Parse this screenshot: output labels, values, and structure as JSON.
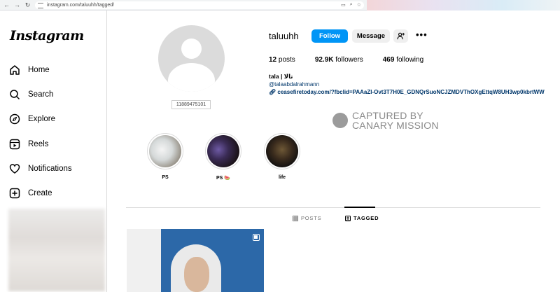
{
  "browser": {
    "url": "instagram.com/taluuhh/tagged/"
  },
  "sidebar": {
    "logo": "Instagram",
    "items": [
      {
        "label": "Home",
        "icon": "home-icon"
      },
      {
        "label": "Search",
        "icon": "search-icon"
      },
      {
        "label": "Explore",
        "icon": "compass-icon"
      },
      {
        "label": "Reels",
        "icon": "reels-icon"
      },
      {
        "label": "Notifications",
        "icon": "heart-icon"
      },
      {
        "label": "Create",
        "icon": "plus-square-icon"
      }
    ]
  },
  "profile": {
    "avatar_label": "11889475101",
    "username": "taluuhh",
    "follow_label": "Follow",
    "message_label": "Message",
    "stats": {
      "posts": "12",
      "posts_label": "posts",
      "followers": "92.9K",
      "followers_label": "followers",
      "following": "469",
      "following_label": "following"
    },
    "full_name": "tala | تالا",
    "handle_link": "@talaabdalrahmann",
    "website": "ceasefiretoday.com/?fbclid=PAAaZl-Ovt3T7H0E_GDNQrSuoNCJZMDVThOXgEttqW8UH3wp0kbrtWW"
  },
  "watermark": {
    "line1": "CAPTURED BY",
    "line2": "CANARY MISSION"
  },
  "highlights": [
    {
      "label": "PS"
    },
    {
      "label": "PS 🍉"
    },
    {
      "label": "life"
    }
  ],
  "tabs": {
    "posts_label": "POSTS",
    "tagged_label": "TAGGED"
  },
  "colors": {
    "follow_button": "#0095f6",
    "link_text": "#00376b",
    "divider": "#dbdbdb"
  }
}
